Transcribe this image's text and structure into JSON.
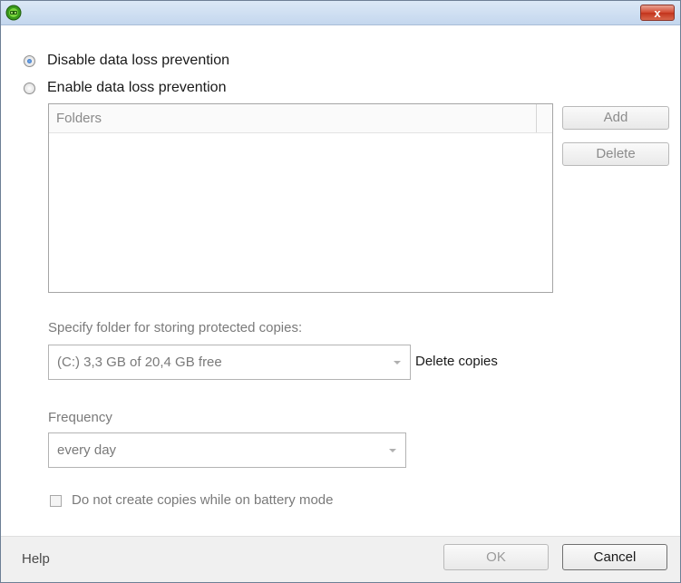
{
  "window": {
    "close_label": "x"
  },
  "dlp_mode": {
    "options": [
      {
        "label": "Disable data loss prevention",
        "checked": true
      },
      {
        "label": "Enable data loss prevention",
        "checked": false
      }
    ]
  },
  "folders": {
    "column_header": "Folders",
    "items": [],
    "add_label": "Add",
    "delete_label": "Delete"
  },
  "storage": {
    "label": "Specify folder for storing protected copies:",
    "selected": "(C:)  3,3 GB of 20,4 GB free",
    "delete_copies_label": "Delete copies"
  },
  "frequency": {
    "label": "Frequency",
    "selected": "every day"
  },
  "battery_option": {
    "label": "Do not create copies while on battery mode",
    "checked": false
  },
  "footer": {
    "help_label": "Help",
    "ok_label": "OK",
    "cancel_label": "Cancel"
  },
  "colors": {
    "title_bar": "#c4d7ee",
    "close_button": "#c2341c",
    "footer_bg": "#f0f0f0",
    "radio_accent": "#1f5fb8"
  }
}
